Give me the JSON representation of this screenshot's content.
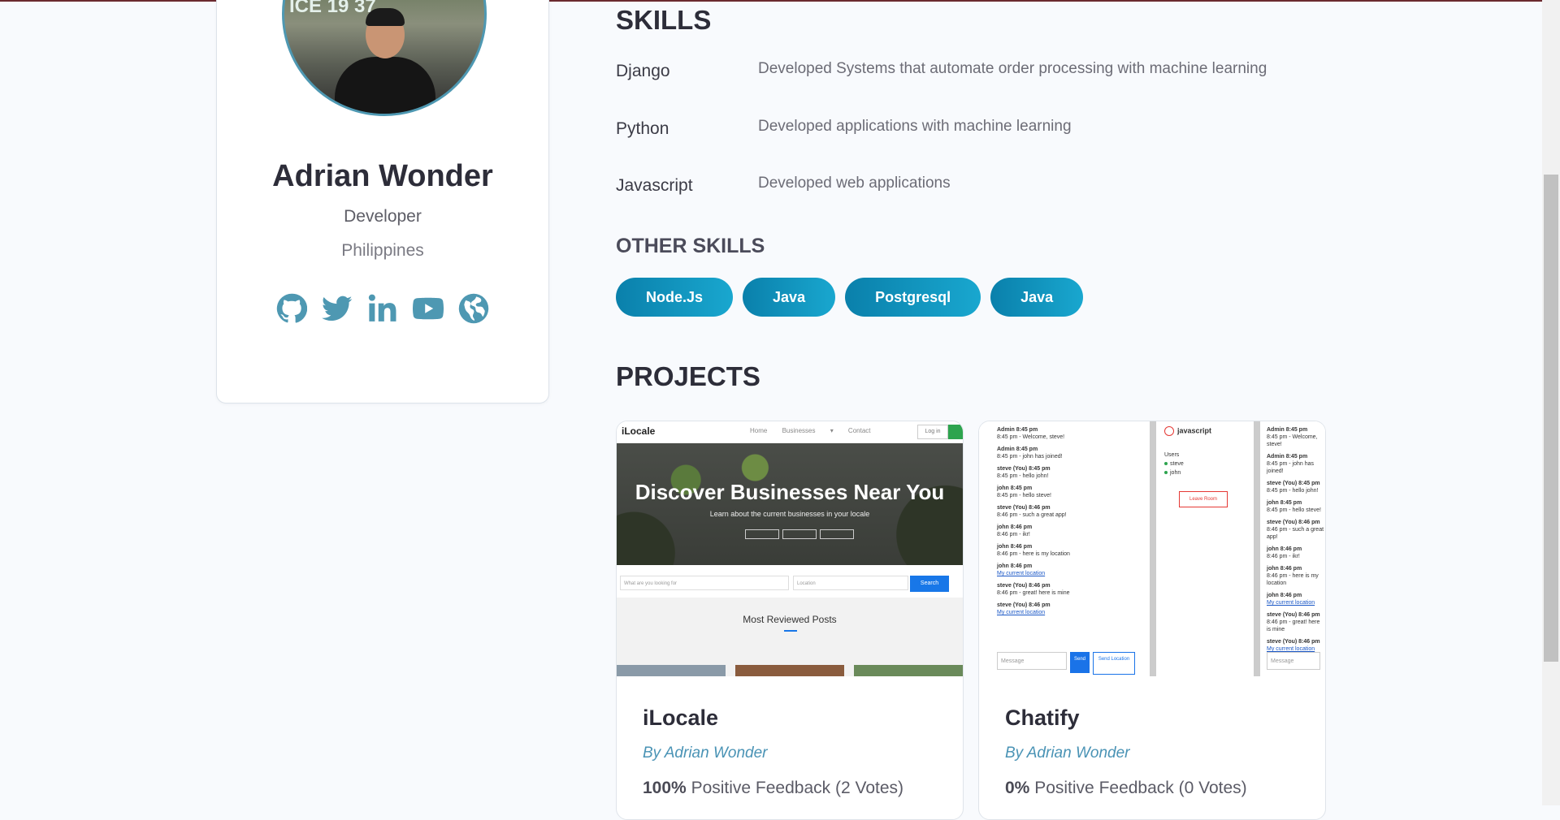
{
  "profile": {
    "avatar_sign": "ICE 19 37",
    "name": "Adrian Wonder",
    "role": "Developer",
    "country": "Philippines",
    "socials": [
      "github-icon",
      "twitter-icon",
      "linkedin-icon",
      "youtube-icon",
      "globe-icon"
    ],
    "social_color": "#4e98b2"
  },
  "skills": {
    "title": "SKILLS",
    "items": [
      {
        "name": "Django",
        "description": "Developed Systems that automate order processing with machine learning"
      },
      {
        "name": "Python",
        "description": "Developed applications with machine learning"
      },
      {
        "name": "Javascript",
        "description": "Developed web applications"
      }
    ]
  },
  "other_skills": {
    "title": "OTHER SKILLS",
    "tags": [
      "Node.Js",
      "Java",
      "Postgresql",
      "Java"
    ],
    "tag_color": "#0a80ab"
  },
  "projects": {
    "title": "PROJECTS",
    "items": [
      {
        "title": "iLocale",
        "author": "By Adrian Wonder",
        "feedback_percent": "100%",
        "feedback_text": "Positive Feedback (2 Votes)",
        "preview": {
          "logo": "iLocale",
          "nav_links": "Home Businesses ▾ Contact",
          "login": "Log in",
          "hero_title": "Discover Businesses Near You",
          "hero_subtitle": "Learn about the current businesses in your locale",
          "search_placeholder": "What are you looking for",
          "location_placeholder": "Location",
          "search_button": "Search",
          "section_title": "Most Reviewed Posts"
        }
      },
      {
        "title": "Chatify",
        "author": "By Adrian Wonder",
        "feedback_percent": "0%",
        "feedback_text": "Positive Feedback (0 Votes)",
        "preview": {
          "room": "javascript",
          "users_label": "Users",
          "users": [
            "steve",
            "john"
          ],
          "leave_button": "Leave Room",
          "message_placeholder": "Message",
          "send_button": "Send",
          "location_button": "Send Location",
          "messages": [
            {
              "who": "Admin",
              "time": "8:45 pm",
              "text": "8:45 pm - Welcome, steve!"
            },
            {
              "who": "Admin",
              "time": "8:45 pm",
              "text": "8:45 pm - john has joined!"
            },
            {
              "who": "steve (You)",
              "time": "8:45 pm",
              "text": "8:45 pm - hello john!"
            },
            {
              "who": "john",
              "time": "8:45 pm",
              "text": "8:45 pm - hello steve!"
            },
            {
              "who": "steve (You)",
              "time": "8:46 pm",
              "text": "8:46 pm - such a great app!"
            },
            {
              "who": "john",
              "time": "8:46 pm",
              "text": "8:46 pm - ikr!"
            },
            {
              "who": "john",
              "time": "8:46 pm",
              "text": "8:46 pm - here is my location"
            },
            {
              "who": "john",
              "time": "8:46 pm",
              "text": "My current location",
              "link": true
            },
            {
              "who": "steve (You)",
              "time": "8:46 pm",
              "text": "8:46 pm - great! here is mine"
            },
            {
              "who": "steve (You)",
              "time": "8:46 pm",
              "text": "My current location",
              "link": true
            }
          ]
        }
      }
    ]
  }
}
